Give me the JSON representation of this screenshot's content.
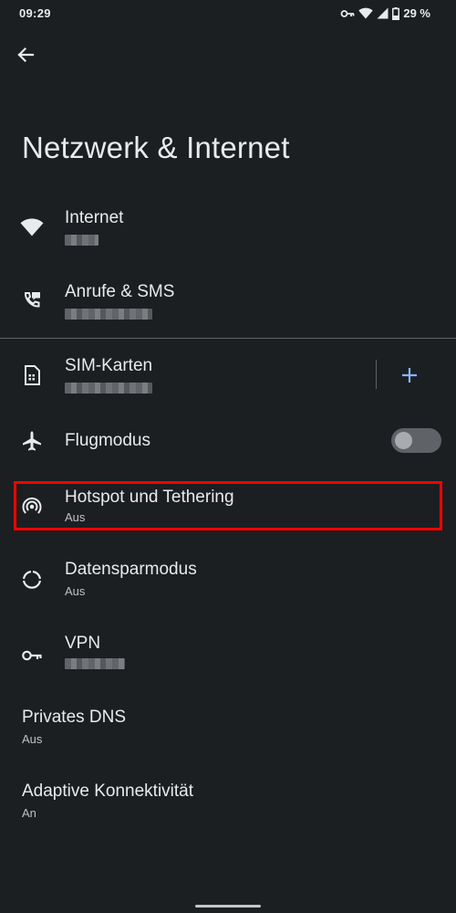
{
  "status_bar": {
    "time": "09:29",
    "battery": "29 %",
    "icons": [
      "vpn-key-icon",
      "wifi-icon",
      "signal-icon",
      "battery-icon"
    ]
  },
  "header": {
    "back_icon": "arrow-back-icon",
    "title": "Netzwerk & Internet"
  },
  "items": [
    {
      "title": "Internet",
      "icon": "wifi-icon",
      "subtitle_redacted": true
    },
    {
      "title": "Anrufe & SMS",
      "icon": "phone-sms-icon",
      "subtitle_redacted": true
    },
    {
      "title": "SIM-Karten",
      "icon": "sim-card-icon",
      "subtitle_redacted": true,
      "action_icon": "add-icon"
    },
    {
      "title": "Flugmodus",
      "icon": "airplane-icon",
      "toggle": "off"
    },
    {
      "title": "Hotspot und Tethering",
      "subtitle": "Aus",
      "icon": "hotspot-icon",
      "highlighted": true
    },
    {
      "title": "Datensparmodus",
      "subtitle": "Aus",
      "icon": "data-saver-icon"
    },
    {
      "title": "VPN",
      "icon": "vpn-key-icon",
      "subtitle_redacted": true
    },
    {
      "title": "Privates DNS",
      "subtitle": "Aus"
    },
    {
      "title": "Adaptive Konnektivität",
      "subtitle": "An"
    }
  ],
  "colors": {
    "background": "#1c1f22",
    "text": "#e8eaed",
    "secondary_text": "#bdc1c6",
    "accent": "#8ab4f8",
    "highlight_border": "#ff0000"
  }
}
